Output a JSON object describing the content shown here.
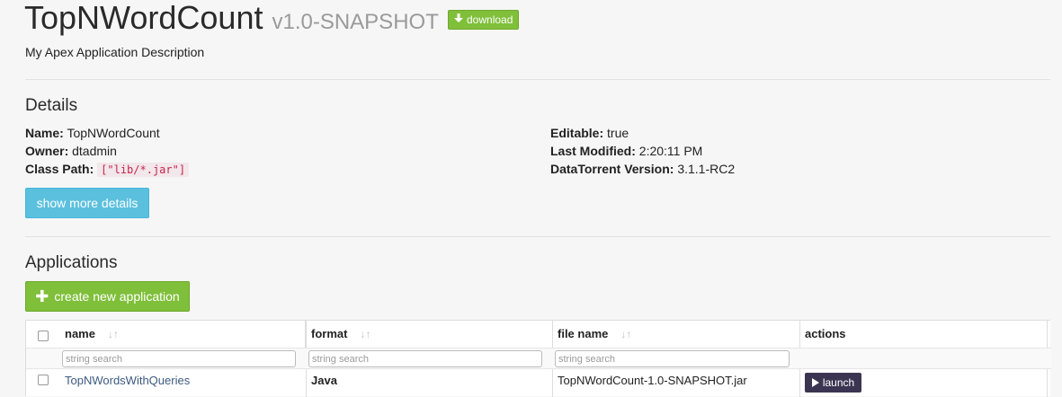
{
  "header": {
    "title": "TopNWordCount",
    "version": "v1.0-SNAPSHOT",
    "download_label": "download",
    "download_icon": "download-arrow-icon",
    "description": "My Apex Application Description"
  },
  "details": {
    "heading": "Details",
    "name_label": "Name:",
    "name_value": "TopNWordCount",
    "owner_label": "Owner:",
    "owner_value": "dtadmin",
    "classpath_label": "Class Path:",
    "classpath_value": "[\"lib/*.jar\"]",
    "editable_label": "Editable:",
    "editable_value": "true",
    "modified_label": "Last Modified:",
    "modified_value": "2:20:11 PM",
    "dt_version_label": "DataTorrent Version:",
    "dt_version_value": "3.1.1-RC2",
    "show_more_label": "show more details"
  },
  "applications": {
    "heading": "Applications",
    "create_label": "create new application",
    "columns": [
      {
        "label": "name",
        "sortable": true
      },
      {
        "label": "format",
        "sortable": true
      },
      {
        "label": "file name",
        "sortable": true
      },
      {
        "label": "actions",
        "sortable": false
      }
    ],
    "search_placeholder": "string search",
    "rows": [
      {
        "name": "TopNWordsWithQueries",
        "format": "Java",
        "file_name": "TopNWordCount-1.0-SNAPSHOT.jar",
        "action_label": "launch"
      }
    ]
  },
  "colors": {
    "success": "#7fbf3a",
    "info": "#5bc0de",
    "launch": "#3b3552",
    "link": "#3d5a80"
  }
}
